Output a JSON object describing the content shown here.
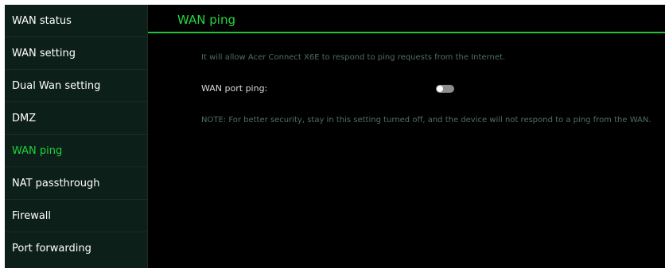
{
  "sidebar": {
    "items": [
      {
        "label": "WAN status",
        "active": false
      },
      {
        "label": "WAN setting",
        "active": false
      },
      {
        "label": "Dual Wan setting",
        "active": false
      },
      {
        "label": "DMZ",
        "active": false
      },
      {
        "label": "WAN ping",
        "active": true
      },
      {
        "label": "NAT passthrough",
        "active": false
      },
      {
        "label": "Firewall",
        "active": false
      },
      {
        "label": "Port forwarding",
        "active": false
      }
    ]
  },
  "main": {
    "title": "WAN ping",
    "description": "It will allow Acer Connect X6E to respond to ping requests from the Internet.",
    "wan_port_ping": {
      "label": "WAN port ping:",
      "enabled": false
    },
    "note": "NOTE: For better security, stay in this setting turned off, and the device will not respond to a ping from the WAN."
  },
  "colors": {
    "accent": "#22d83c",
    "sidebar_bg": "#0d1f19",
    "main_bg": "#000000",
    "toggle_off": "#8d8f8e"
  }
}
